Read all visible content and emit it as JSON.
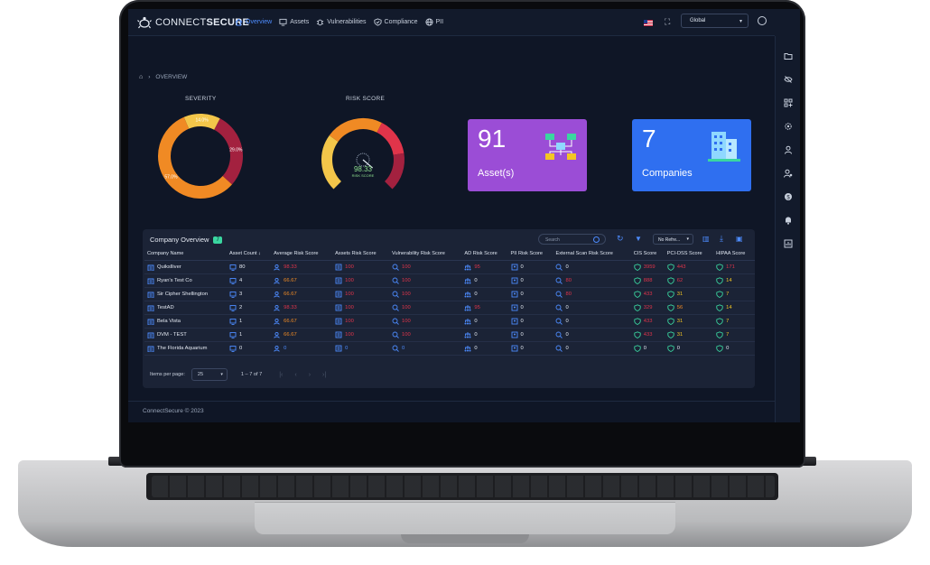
{
  "app": {
    "brand_left": "CONNECT",
    "brand_right": "SECURE"
  },
  "nav": [
    {
      "label": "Overview",
      "icon": "home-icon",
      "active": true
    },
    {
      "label": "Assets",
      "icon": "monitor-icon"
    },
    {
      "label": "Vulnerabilities",
      "icon": "bug-icon"
    },
    {
      "label": "Compliance",
      "icon": "shield-check-icon"
    },
    {
      "label": "PII",
      "icon": "globe-icon"
    }
  ],
  "header": {
    "scope_select": "Global"
  },
  "breadcrumb": {
    "current": "OVERVIEW"
  },
  "severity": {
    "title": "SEVERITY",
    "segments": [
      {
        "label": "14.0%",
        "value": 14.0,
        "color": "#f3c64a"
      },
      {
        "label": "29.0%",
        "value": 29.0,
        "color": "#a3213f"
      },
      {
        "label": "57.0%",
        "value": 57.0,
        "color": "#f08a24"
      }
    ]
  },
  "risk_score": {
    "title": "RISK SCORE",
    "value": "98.33",
    "caption": "RISK SCORE",
    "value_number": 98.33
  },
  "cards": {
    "assets": {
      "number": "91",
      "label": "Asset(s)",
      "color": "#9b4dd6"
    },
    "companies": {
      "number": "7",
      "label": "Companies",
      "color": "#2f6ff0"
    }
  },
  "company_overview": {
    "title": "Company Overview",
    "count": "7",
    "search_placeholder": "Search",
    "refresh_select": "No Refre...",
    "columns": [
      "Company Name",
      "Asset Count",
      "Average Risk Score",
      "Assets Risk Score",
      "Vulnerability Risk Score",
      "AD Risk Score",
      "PII Risk Score",
      "External Scan Risk Score",
      "CIS Score",
      "PCI-DSS Score",
      "HIPAA Score"
    ],
    "rows": [
      {
        "name": "Quikslliver",
        "asset_count": "80",
        "avg": "98.33",
        "assets": "100",
        "vuln": "100",
        "ad": "95",
        "pii": "0",
        "ext": "0",
        "cis": "3959",
        "pci": "443",
        "hipaa": "171",
        "colors": {
          "avg": "red",
          "assets": "red",
          "vuln": "red",
          "ad": "red",
          "pii": "white",
          "ext": "white",
          "cis": "red",
          "pci": "red",
          "hipaa": "red"
        }
      },
      {
        "name": "Ryan's Test Co",
        "asset_count": "4",
        "avg": "66.67",
        "assets": "100",
        "vuln": "100",
        "ad": "0",
        "pii": "0",
        "ext": "80",
        "cis": "888",
        "pci": "62",
        "hipaa": "14",
        "colors": {
          "avg": "orange",
          "assets": "red",
          "vuln": "red",
          "ad": "white",
          "pii": "white",
          "ext": "red",
          "cis": "red",
          "pci": "red",
          "hipaa": "yellow"
        }
      },
      {
        "name": "Sir Cipher Shellington",
        "asset_count": "3",
        "avg": "66.67",
        "assets": "100",
        "vuln": "100",
        "ad": "0",
        "pii": "0",
        "ext": "80",
        "cis": "433",
        "pci": "31",
        "hipaa": "7",
        "colors": {
          "avg": "orange",
          "assets": "red",
          "vuln": "red",
          "ad": "white",
          "pii": "white",
          "ext": "red",
          "cis": "red",
          "pci": "yellow",
          "hipaa": "yellow"
        }
      },
      {
        "name": "TestAD",
        "asset_count": "2",
        "avg": "98.33",
        "assets": "100",
        "vuln": "100",
        "ad": "95",
        "pii": "0",
        "ext": "0",
        "cis": "329",
        "pci": "56",
        "hipaa": "14",
        "colors": {
          "avg": "red",
          "assets": "red",
          "vuln": "red",
          "ad": "red",
          "pii": "white",
          "ext": "white",
          "cis": "red",
          "pci": "orange",
          "hipaa": "yellow"
        }
      },
      {
        "name": "Bela Vista",
        "asset_count": "1",
        "avg": "66.67",
        "assets": "100",
        "vuln": "100",
        "ad": "0",
        "pii": "0",
        "ext": "0",
        "cis": "433",
        "pci": "31",
        "hipaa": "7",
        "colors": {
          "avg": "orange",
          "assets": "red",
          "vuln": "red",
          "ad": "white",
          "pii": "white",
          "ext": "white",
          "cis": "red",
          "pci": "yellow",
          "hipaa": "yellow"
        }
      },
      {
        "name": "DVM - TEST",
        "asset_count": "1",
        "avg": "66.67",
        "assets": "100",
        "vuln": "100",
        "ad": "0",
        "pii": "0",
        "ext": "0",
        "cis": "433",
        "pci": "31",
        "hipaa": "7",
        "colors": {
          "avg": "orange",
          "assets": "red",
          "vuln": "red",
          "ad": "white",
          "pii": "white",
          "ext": "white",
          "cis": "red",
          "pci": "yellow",
          "hipaa": "yellow"
        }
      },
      {
        "name": "The Florida Aquarium",
        "asset_count": "0",
        "avg": "0",
        "assets": "0",
        "vuln": "0",
        "ad": "0",
        "pii": "0",
        "ext": "0",
        "cis": "0",
        "pci": "0",
        "hipaa": "0",
        "colors": {
          "avg": "blue",
          "assets": "blue",
          "vuln": "blue",
          "ad": "white",
          "pii": "white",
          "ext": "white",
          "cis": "white",
          "pci": "white",
          "hipaa": "white"
        }
      }
    ],
    "pagination": {
      "label": "Items per page:",
      "page_size": "25",
      "range": "1 – 7 of 7"
    }
  },
  "footer": {
    "copyright": "ConnectSecure © 2023"
  }
}
